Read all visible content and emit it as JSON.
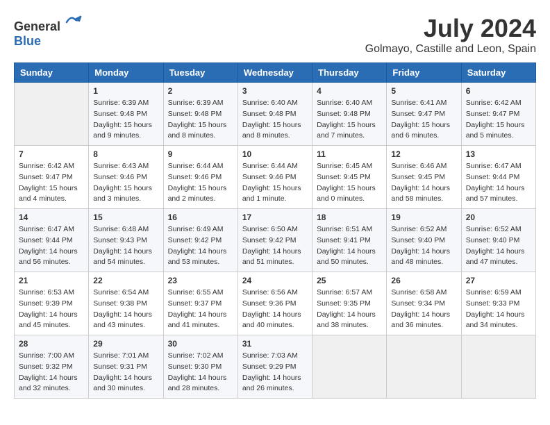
{
  "header": {
    "logo_general": "General",
    "logo_blue": "Blue",
    "title": "July 2024",
    "subtitle": "Golmayo, Castille and Leon, Spain"
  },
  "weekdays": [
    "Sunday",
    "Monday",
    "Tuesday",
    "Wednesday",
    "Thursday",
    "Friday",
    "Saturday"
  ],
  "weeks": [
    [
      {
        "day": "",
        "sunrise": "",
        "sunset": "",
        "daylight": "",
        "empty": true
      },
      {
        "day": "1",
        "sunrise": "Sunrise: 6:39 AM",
        "sunset": "Sunset: 9:48 PM",
        "daylight": "Daylight: 15 hours and 9 minutes.",
        "empty": false
      },
      {
        "day": "2",
        "sunrise": "Sunrise: 6:39 AM",
        "sunset": "Sunset: 9:48 PM",
        "daylight": "Daylight: 15 hours and 8 minutes.",
        "empty": false
      },
      {
        "day": "3",
        "sunrise": "Sunrise: 6:40 AM",
        "sunset": "Sunset: 9:48 PM",
        "daylight": "Daylight: 15 hours and 8 minutes.",
        "empty": false
      },
      {
        "day": "4",
        "sunrise": "Sunrise: 6:40 AM",
        "sunset": "Sunset: 9:48 PM",
        "daylight": "Daylight: 15 hours and 7 minutes.",
        "empty": false
      },
      {
        "day": "5",
        "sunrise": "Sunrise: 6:41 AM",
        "sunset": "Sunset: 9:47 PM",
        "daylight": "Daylight: 15 hours and 6 minutes.",
        "empty": false
      },
      {
        "day": "6",
        "sunrise": "Sunrise: 6:42 AM",
        "sunset": "Sunset: 9:47 PM",
        "daylight": "Daylight: 15 hours and 5 minutes.",
        "empty": false
      }
    ],
    [
      {
        "day": "7",
        "sunrise": "Sunrise: 6:42 AM",
        "sunset": "Sunset: 9:47 PM",
        "daylight": "Daylight: 15 hours and 4 minutes.",
        "empty": false
      },
      {
        "day": "8",
        "sunrise": "Sunrise: 6:43 AM",
        "sunset": "Sunset: 9:46 PM",
        "daylight": "Daylight: 15 hours and 3 minutes.",
        "empty": false
      },
      {
        "day": "9",
        "sunrise": "Sunrise: 6:44 AM",
        "sunset": "Sunset: 9:46 PM",
        "daylight": "Daylight: 15 hours and 2 minutes.",
        "empty": false
      },
      {
        "day": "10",
        "sunrise": "Sunrise: 6:44 AM",
        "sunset": "Sunset: 9:46 PM",
        "daylight": "Daylight: 15 hours and 1 minute.",
        "empty": false
      },
      {
        "day": "11",
        "sunrise": "Sunrise: 6:45 AM",
        "sunset": "Sunset: 9:45 PM",
        "daylight": "Daylight: 15 hours and 0 minutes.",
        "empty": false
      },
      {
        "day": "12",
        "sunrise": "Sunrise: 6:46 AM",
        "sunset": "Sunset: 9:45 PM",
        "daylight": "Daylight: 14 hours and 58 minutes.",
        "empty": false
      },
      {
        "day": "13",
        "sunrise": "Sunrise: 6:47 AM",
        "sunset": "Sunset: 9:44 PM",
        "daylight": "Daylight: 14 hours and 57 minutes.",
        "empty": false
      }
    ],
    [
      {
        "day": "14",
        "sunrise": "Sunrise: 6:47 AM",
        "sunset": "Sunset: 9:44 PM",
        "daylight": "Daylight: 14 hours and 56 minutes.",
        "empty": false
      },
      {
        "day": "15",
        "sunrise": "Sunrise: 6:48 AM",
        "sunset": "Sunset: 9:43 PM",
        "daylight": "Daylight: 14 hours and 54 minutes.",
        "empty": false
      },
      {
        "day": "16",
        "sunrise": "Sunrise: 6:49 AM",
        "sunset": "Sunset: 9:42 PM",
        "daylight": "Daylight: 14 hours and 53 minutes.",
        "empty": false
      },
      {
        "day": "17",
        "sunrise": "Sunrise: 6:50 AM",
        "sunset": "Sunset: 9:42 PM",
        "daylight": "Daylight: 14 hours and 51 minutes.",
        "empty": false
      },
      {
        "day": "18",
        "sunrise": "Sunrise: 6:51 AM",
        "sunset": "Sunset: 9:41 PM",
        "daylight": "Daylight: 14 hours and 50 minutes.",
        "empty": false
      },
      {
        "day": "19",
        "sunrise": "Sunrise: 6:52 AM",
        "sunset": "Sunset: 9:40 PM",
        "daylight": "Daylight: 14 hours and 48 minutes.",
        "empty": false
      },
      {
        "day": "20",
        "sunrise": "Sunrise: 6:52 AM",
        "sunset": "Sunset: 9:40 PM",
        "daylight": "Daylight: 14 hours and 47 minutes.",
        "empty": false
      }
    ],
    [
      {
        "day": "21",
        "sunrise": "Sunrise: 6:53 AM",
        "sunset": "Sunset: 9:39 PM",
        "daylight": "Daylight: 14 hours and 45 minutes.",
        "empty": false
      },
      {
        "day": "22",
        "sunrise": "Sunrise: 6:54 AM",
        "sunset": "Sunset: 9:38 PM",
        "daylight": "Daylight: 14 hours and 43 minutes.",
        "empty": false
      },
      {
        "day": "23",
        "sunrise": "Sunrise: 6:55 AM",
        "sunset": "Sunset: 9:37 PM",
        "daylight": "Daylight: 14 hours and 41 minutes.",
        "empty": false
      },
      {
        "day": "24",
        "sunrise": "Sunrise: 6:56 AM",
        "sunset": "Sunset: 9:36 PM",
        "daylight": "Daylight: 14 hours and 40 minutes.",
        "empty": false
      },
      {
        "day": "25",
        "sunrise": "Sunrise: 6:57 AM",
        "sunset": "Sunset: 9:35 PM",
        "daylight": "Daylight: 14 hours and 38 minutes.",
        "empty": false
      },
      {
        "day": "26",
        "sunrise": "Sunrise: 6:58 AM",
        "sunset": "Sunset: 9:34 PM",
        "daylight": "Daylight: 14 hours and 36 minutes.",
        "empty": false
      },
      {
        "day": "27",
        "sunrise": "Sunrise: 6:59 AM",
        "sunset": "Sunset: 9:33 PM",
        "daylight": "Daylight: 14 hours and 34 minutes.",
        "empty": false
      }
    ],
    [
      {
        "day": "28",
        "sunrise": "Sunrise: 7:00 AM",
        "sunset": "Sunset: 9:32 PM",
        "daylight": "Daylight: 14 hours and 32 minutes.",
        "empty": false
      },
      {
        "day": "29",
        "sunrise": "Sunrise: 7:01 AM",
        "sunset": "Sunset: 9:31 PM",
        "daylight": "Daylight: 14 hours and 30 minutes.",
        "empty": false
      },
      {
        "day": "30",
        "sunrise": "Sunrise: 7:02 AM",
        "sunset": "Sunset: 9:30 PM",
        "daylight": "Daylight: 14 hours and 28 minutes.",
        "empty": false
      },
      {
        "day": "31",
        "sunrise": "Sunrise: 7:03 AM",
        "sunset": "Sunset: 9:29 PM",
        "daylight": "Daylight: 14 hours and 26 minutes.",
        "empty": false
      },
      {
        "day": "",
        "sunrise": "",
        "sunset": "",
        "daylight": "",
        "empty": true
      },
      {
        "day": "",
        "sunrise": "",
        "sunset": "",
        "daylight": "",
        "empty": true
      },
      {
        "day": "",
        "sunrise": "",
        "sunset": "",
        "daylight": "",
        "empty": true
      }
    ]
  ]
}
